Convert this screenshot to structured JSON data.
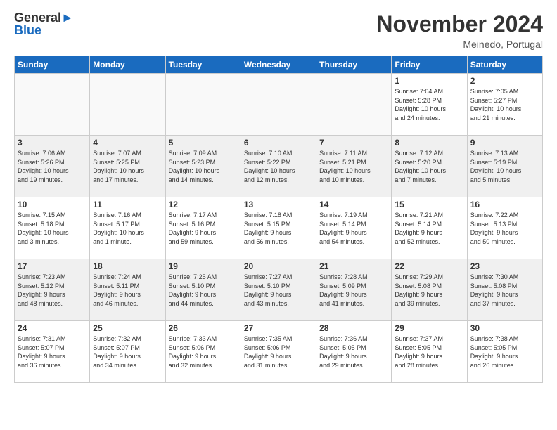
{
  "header": {
    "logo_line1": "General",
    "logo_line2": "Blue",
    "month": "November 2024",
    "location": "Meinedo, Portugal"
  },
  "days_of_week": [
    "Sunday",
    "Monday",
    "Tuesday",
    "Wednesday",
    "Thursday",
    "Friday",
    "Saturday"
  ],
  "weeks": [
    {
      "shaded": false,
      "days": [
        {
          "num": "",
          "info": ""
        },
        {
          "num": "",
          "info": ""
        },
        {
          "num": "",
          "info": ""
        },
        {
          "num": "",
          "info": ""
        },
        {
          "num": "",
          "info": ""
        },
        {
          "num": "1",
          "info": "Sunrise: 7:04 AM\nSunset: 5:28 PM\nDaylight: 10 hours\nand 24 minutes."
        },
        {
          "num": "2",
          "info": "Sunrise: 7:05 AM\nSunset: 5:27 PM\nDaylight: 10 hours\nand 21 minutes."
        }
      ]
    },
    {
      "shaded": true,
      "days": [
        {
          "num": "3",
          "info": "Sunrise: 7:06 AM\nSunset: 5:26 PM\nDaylight: 10 hours\nand 19 minutes."
        },
        {
          "num": "4",
          "info": "Sunrise: 7:07 AM\nSunset: 5:25 PM\nDaylight: 10 hours\nand 17 minutes."
        },
        {
          "num": "5",
          "info": "Sunrise: 7:09 AM\nSunset: 5:23 PM\nDaylight: 10 hours\nand 14 minutes."
        },
        {
          "num": "6",
          "info": "Sunrise: 7:10 AM\nSunset: 5:22 PM\nDaylight: 10 hours\nand 12 minutes."
        },
        {
          "num": "7",
          "info": "Sunrise: 7:11 AM\nSunset: 5:21 PM\nDaylight: 10 hours\nand 10 minutes."
        },
        {
          "num": "8",
          "info": "Sunrise: 7:12 AM\nSunset: 5:20 PM\nDaylight: 10 hours\nand 7 minutes."
        },
        {
          "num": "9",
          "info": "Sunrise: 7:13 AM\nSunset: 5:19 PM\nDaylight: 10 hours\nand 5 minutes."
        }
      ]
    },
    {
      "shaded": false,
      "days": [
        {
          "num": "10",
          "info": "Sunrise: 7:15 AM\nSunset: 5:18 PM\nDaylight: 10 hours\nand 3 minutes."
        },
        {
          "num": "11",
          "info": "Sunrise: 7:16 AM\nSunset: 5:17 PM\nDaylight: 10 hours\nand 1 minute."
        },
        {
          "num": "12",
          "info": "Sunrise: 7:17 AM\nSunset: 5:16 PM\nDaylight: 9 hours\nand 59 minutes."
        },
        {
          "num": "13",
          "info": "Sunrise: 7:18 AM\nSunset: 5:15 PM\nDaylight: 9 hours\nand 56 minutes."
        },
        {
          "num": "14",
          "info": "Sunrise: 7:19 AM\nSunset: 5:14 PM\nDaylight: 9 hours\nand 54 minutes."
        },
        {
          "num": "15",
          "info": "Sunrise: 7:21 AM\nSunset: 5:14 PM\nDaylight: 9 hours\nand 52 minutes."
        },
        {
          "num": "16",
          "info": "Sunrise: 7:22 AM\nSunset: 5:13 PM\nDaylight: 9 hours\nand 50 minutes."
        }
      ]
    },
    {
      "shaded": true,
      "days": [
        {
          "num": "17",
          "info": "Sunrise: 7:23 AM\nSunset: 5:12 PM\nDaylight: 9 hours\nand 48 minutes."
        },
        {
          "num": "18",
          "info": "Sunrise: 7:24 AM\nSunset: 5:11 PM\nDaylight: 9 hours\nand 46 minutes."
        },
        {
          "num": "19",
          "info": "Sunrise: 7:25 AM\nSunset: 5:10 PM\nDaylight: 9 hours\nand 44 minutes."
        },
        {
          "num": "20",
          "info": "Sunrise: 7:27 AM\nSunset: 5:10 PM\nDaylight: 9 hours\nand 43 minutes."
        },
        {
          "num": "21",
          "info": "Sunrise: 7:28 AM\nSunset: 5:09 PM\nDaylight: 9 hours\nand 41 minutes."
        },
        {
          "num": "22",
          "info": "Sunrise: 7:29 AM\nSunset: 5:08 PM\nDaylight: 9 hours\nand 39 minutes."
        },
        {
          "num": "23",
          "info": "Sunrise: 7:30 AM\nSunset: 5:08 PM\nDaylight: 9 hours\nand 37 minutes."
        }
      ]
    },
    {
      "shaded": false,
      "days": [
        {
          "num": "24",
          "info": "Sunrise: 7:31 AM\nSunset: 5:07 PM\nDaylight: 9 hours\nand 36 minutes."
        },
        {
          "num": "25",
          "info": "Sunrise: 7:32 AM\nSunset: 5:07 PM\nDaylight: 9 hours\nand 34 minutes."
        },
        {
          "num": "26",
          "info": "Sunrise: 7:33 AM\nSunset: 5:06 PM\nDaylight: 9 hours\nand 32 minutes."
        },
        {
          "num": "27",
          "info": "Sunrise: 7:35 AM\nSunset: 5:06 PM\nDaylight: 9 hours\nand 31 minutes."
        },
        {
          "num": "28",
          "info": "Sunrise: 7:36 AM\nSunset: 5:05 PM\nDaylight: 9 hours\nand 29 minutes."
        },
        {
          "num": "29",
          "info": "Sunrise: 7:37 AM\nSunset: 5:05 PM\nDaylight: 9 hours\nand 28 minutes."
        },
        {
          "num": "30",
          "info": "Sunrise: 7:38 AM\nSunset: 5:05 PM\nDaylight: 9 hours\nand 26 minutes."
        }
      ]
    }
  ]
}
